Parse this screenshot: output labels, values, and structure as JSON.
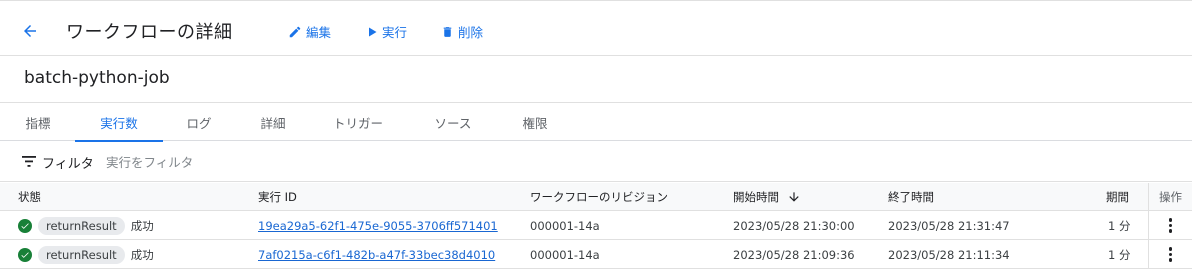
{
  "header": {
    "title": "ワークフローの詳細",
    "actions": {
      "edit": "編集",
      "run": "実行",
      "delete": "削除"
    }
  },
  "job": {
    "name": "batch-python-job"
  },
  "tabs": [
    {
      "label": "指標",
      "active": false
    },
    {
      "label": "実行数",
      "active": true
    },
    {
      "label": "ログ",
      "active": false
    },
    {
      "label": "詳細",
      "active": false
    },
    {
      "label": "トリガー",
      "active": false
    },
    {
      "label": "ソース",
      "active": false
    },
    {
      "label": "権限",
      "active": false
    }
  ],
  "filter": {
    "label": "フィルタ",
    "placeholder": "実行をフィルタ"
  },
  "table": {
    "columns": {
      "status": "状態",
      "execution_id": "実行 ID",
      "revision": "ワークフローのリビジョン",
      "start_time": "開始時間",
      "end_time": "終了時間",
      "duration": "期間",
      "actions": "操作"
    },
    "sort": {
      "column": "start_time",
      "direction": "descending"
    },
    "rows": [
      {
        "result_chip": "returnResult",
        "status": "成功",
        "execution_id": "19ea29a5-62f1-475e-9055-3706ff571401",
        "revision": "000001-14a",
        "start_time": "2023/05/28 21:30:00",
        "end_time": "2023/05/28 21:31:47",
        "duration": "1 分"
      },
      {
        "result_chip": "returnResult",
        "status": "成功",
        "execution_id": "7af0215a-c6f1-482b-a47f-33bec38d4010",
        "revision": "000001-14a",
        "start_time": "2023/05/28 21:09:36",
        "end_time": "2023/05/28 21:11:34",
        "duration": "1 分"
      }
    ]
  },
  "colors": {
    "accent": "#1a73e8",
    "success": "#188038",
    "link": "#1967d2"
  }
}
